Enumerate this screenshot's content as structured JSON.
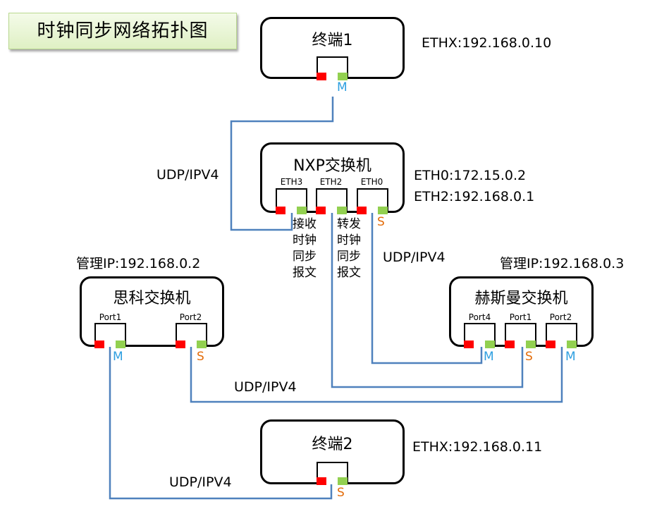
{
  "title": "时钟同步网络拓扑图",
  "colors": {
    "link": "#4f81bd",
    "master": "#2e9fe0",
    "slave": "#e36c0a",
    "port_red": "#ff0000",
    "port_green": "#92d050"
  },
  "terminal1": {
    "name": "终端1",
    "ip": "ETHX:192.168.0.10",
    "role": "M"
  },
  "nxp": {
    "name": "NXP交换机",
    "ip0": "ETH0:172.15.0.2",
    "ip2": "ETH2:192.168.0.1",
    "ports": [
      "ETH3",
      "ETH2",
      "ETH0"
    ],
    "eth0_role": "S"
  },
  "cisco": {
    "mgmt": "管理IP:192.168.0.2",
    "name": "思科交换机",
    "ports": [
      "Port1",
      "Port2"
    ],
    "roles": [
      "M",
      "S"
    ]
  },
  "hesman": {
    "mgmt": "管理IP:192.168.0.3",
    "name": "赫斯曼交换机",
    "ports": [
      "Port4",
      "Port1",
      "Port2"
    ],
    "roles": [
      "M",
      "S",
      "M"
    ]
  },
  "terminal2": {
    "name": "终端2",
    "ip": "ETHX:192.168.0.11",
    "role": "S"
  },
  "labels": {
    "udp_top": "UDP/IPV4",
    "udp_mid": "UDP/IPV4",
    "udp_low": "UDP/IPV4",
    "udp_bottom": "UDP/IPV4",
    "recv": [
      "接收",
      "时钟",
      "同步",
      "报文"
    ],
    "fwd": [
      "转发",
      "时钟",
      "同步",
      "报文"
    ]
  }
}
